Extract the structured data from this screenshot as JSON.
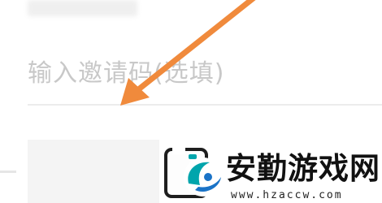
{
  "invite_code": {
    "placeholder": "输入邀请码(选填)",
    "value": ""
  },
  "watermark": {
    "title": "安勤游戏网",
    "url": "www.hzaccw.com"
  },
  "annotation": {
    "arrow_color": "#f08a3c"
  },
  "colors": {
    "logo_teal": "#00a5ac",
    "logo_blue": "#1a73c7"
  },
  "icons": {
    "photo": "photo-frame-icon",
    "logo": "site-logo-icon",
    "arrow": "annotation-arrow"
  }
}
